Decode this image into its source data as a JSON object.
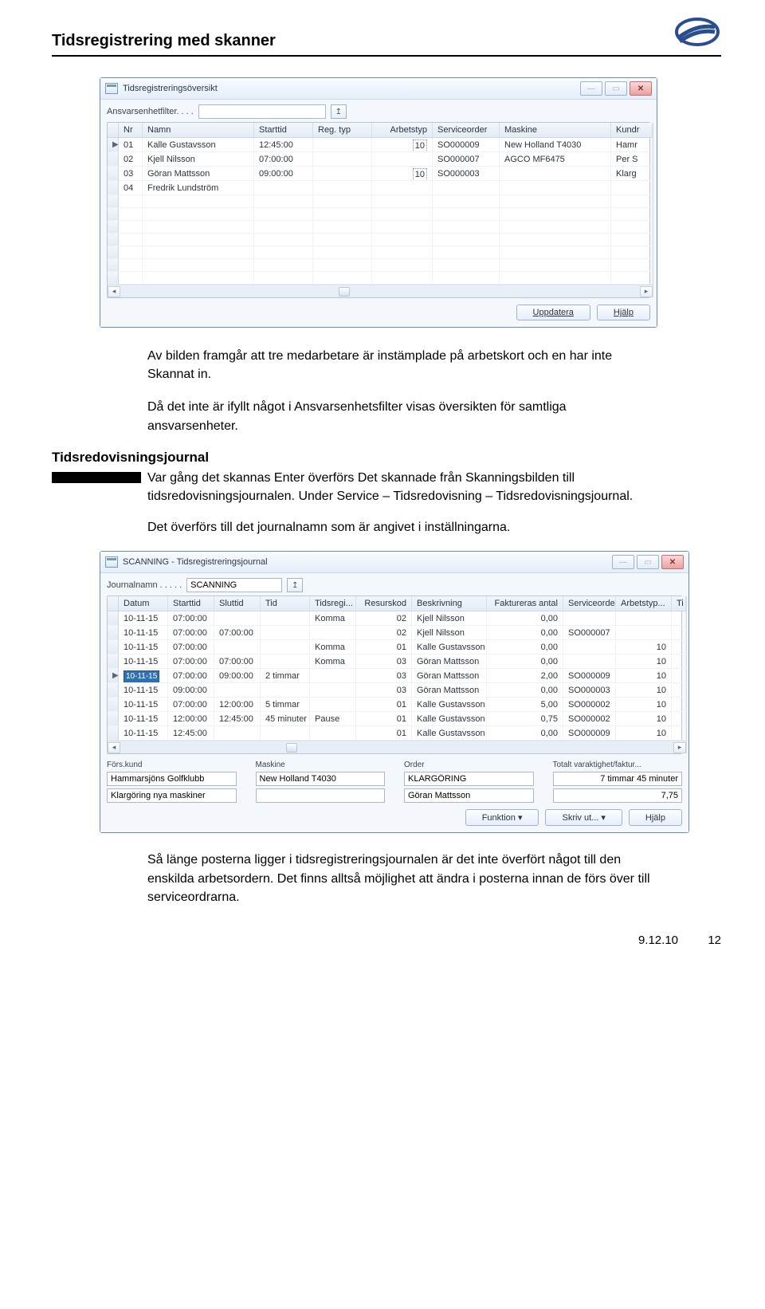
{
  "header": {
    "title": "Tidsregistrering med skanner"
  },
  "win1": {
    "title": "Tidsregistreringsöversikt",
    "filterLabel": "Ansvarsenhetfilter. . . .",
    "filterValue": "",
    "cols": [
      "Nr",
      "Namn",
      "Starttid",
      "Reg. typ",
      "Arbetstyp",
      "Serviceorder",
      "Maskine",
      "Kundr"
    ],
    "rows": [
      {
        "mark": "▶",
        "nr": "01",
        "namn": "Kalle Gustavsson",
        "start": "12:45:00",
        "reg": "",
        "arb": "10",
        "so": "SO000009",
        "mask": "New Holland T4030",
        "kund": "Hamr"
      },
      {
        "mark": "",
        "nr": "02",
        "namn": "Kjell Nilsson",
        "start": "07:00:00",
        "reg": "",
        "arb": "",
        "so": "SO000007",
        "mask": "AGCO MF6475",
        "kund": "Per S"
      },
      {
        "mark": "",
        "nr": "03",
        "namn": "Göran Mattsson",
        "start": "09:00:00",
        "reg": "",
        "arb": "10",
        "so": "SO000003",
        "mask": "",
        "kund": "Klarg"
      },
      {
        "mark": "",
        "nr": "04",
        "namn": "Fredrik Lundström",
        "start": "",
        "reg": "",
        "arb": "",
        "so": "",
        "mask": "",
        "kund": ""
      }
    ],
    "btnUpdate": "Uppdatera",
    "btnHelp": "Hjälp"
  },
  "para1": "Av bilden framgår att tre medarbetare är instämplade på arbetskort och en har inte Skannat in.",
  "para2": "Då det inte är ifyllt något i Ansvarsenhetsfilter visas översikten för samtliga ansvarsenheter.",
  "section2": {
    "title": "Tidsredovisningsjournal",
    "text1": "Var gång det skannas Enter överförs Det skannade från Skanningsbilden till tidsredovisningsjournalen. Under Service – Tidsredovisning – Tidsredovisningsjournal.",
    "text2": "Det överförs till det journalnamn som är angivet i inställningarna."
  },
  "win2": {
    "title": "SCANNING - Tidsregistreringsjournal",
    "journLabel": "Journalnamn . . . . .",
    "journValue": "SCANNING",
    "cols": [
      "Datum",
      "Starttid",
      "Sluttid",
      "Tid",
      "Tidsregi...",
      "Resurskod",
      "Beskrivning",
      "Faktureras antal",
      "Serviceorder",
      "Arbetstyp...",
      "Ti"
    ],
    "rows": [
      {
        "d": "10-11-15",
        "st": "07:00:00",
        "sl": "",
        "tid": "",
        "tr": "Komma",
        "rk": "02",
        "be": "Kjell Nilsson",
        "fa": "0,00",
        "so": "",
        "at": "",
        "ti": ""
      },
      {
        "d": "10-11-15",
        "st": "07:00:00",
        "sl": "07:00:00",
        "tid": "",
        "tr": "",
        "rk": "02",
        "be": "Kjell Nilsson",
        "fa": "0,00",
        "so": "SO000007",
        "at": "",
        "ti": ""
      },
      {
        "d": "10-11-15",
        "st": "07:00:00",
        "sl": "",
        "tid": "",
        "tr": "Komma",
        "rk": "01",
        "be": "Kalle Gustavsson",
        "fa": "0,00",
        "so": "",
        "at": "10",
        "ti": ""
      },
      {
        "d": "10-11-15",
        "st": "07:00:00",
        "sl": "07:00:00",
        "tid": "",
        "tr": "Komma",
        "rk": "03",
        "be": "Göran Mattsson",
        "fa": "0,00",
        "so": "",
        "at": "10",
        "ti": ""
      },
      {
        "sel": true,
        "d": "10-11-15",
        "st": "07:00:00",
        "sl": "09:00:00",
        "tid": "2 timmar",
        "tr": "",
        "rk": "03",
        "be": "Göran Mattsson",
        "fa": "2,00",
        "so": "SO000009",
        "at": "10",
        "ti": ""
      },
      {
        "d": "10-11-15",
        "st": "09:00:00",
        "sl": "",
        "tid": "",
        "tr": "",
        "rk": "03",
        "be": "Göran Mattsson",
        "fa": "0,00",
        "so": "SO000003",
        "at": "10",
        "ti": ""
      },
      {
        "d": "10-11-15",
        "st": "07:00:00",
        "sl": "12:00:00",
        "tid": "5 timmar",
        "tr": "",
        "rk": "01",
        "be": "Kalle Gustavsson",
        "fa": "5,00",
        "so": "SO000002",
        "at": "10",
        "ti": ""
      },
      {
        "d": "10-11-15",
        "st": "12:00:00",
        "sl": "12:45:00",
        "tid": "45 minuter",
        "tr": "Pause",
        "rk": "01",
        "be": "Kalle Gustavsson",
        "fa": "0,75",
        "so": "SO000002",
        "at": "10",
        "ti": ""
      },
      {
        "d": "10-11-15",
        "st": "12:45:00",
        "sl": "",
        "tid": "",
        "tr": "",
        "rk": "01",
        "be": "Kalle Gustavsson",
        "fa": "0,00",
        "so": "SO000009",
        "at": "10",
        "ti": ""
      }
    ],
    "summary": {
      "forsLabel": "Förs.kund",
      "fors1": "Hammarsjöns Golfklubb",
      "fors2": "Klargöring nya maskiner",
      "maskLabel": "Maskine",
      "mask1": "New Holland T4030",
      "mask2": "",
      "orderLabel": "Order",
      "order1": "KLARGÖRING",
      "order2": "Göran Mattsson",
      "totLabel": "Totalt varaktighet/faktur...",
      "tot1": "7 timmar 45 minuter",
      "tot2": "7,75"
    },
    "btnFunc": "Funktion",
    "btnPrint": "Skriv ut...",
    "btnHelp": "Hjälp"
  },
  "para3": "Så länge posterna ligger i tidsregistreringsjournalen är det inte överfört något till den enskilda arbetsordern. Det finns alltså möjlighet att ändra i posterna innan de förs över till serviceordrarna.",
  "footer": {
    "ver": "9.12.10",
    "page": "12"
  }
}
